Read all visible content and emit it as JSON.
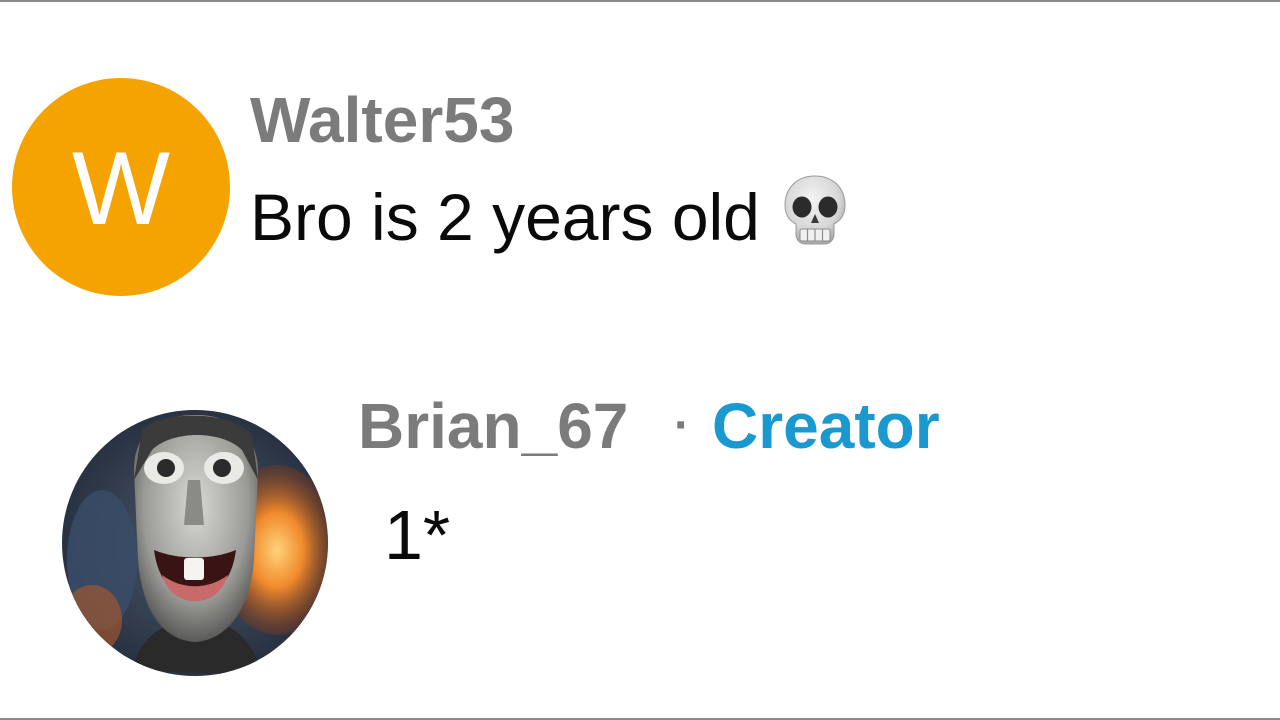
{
  "comments": [
    {
      "avatar_letter": "W",
      "avatar_color": "#f5a300",
      "username": "Walter53",
      "text": "Bro is 2 years old",
      "emoji": "skull-icon"
    }
  ],
  "reply": {
    "username": "Brian_67",
    "separator": "·",
    "badge": "Creator",
    "badge_color": "#1a98d0",
    "text": "1*",
    "avatar": "creepy-face-photo"
  }
}
